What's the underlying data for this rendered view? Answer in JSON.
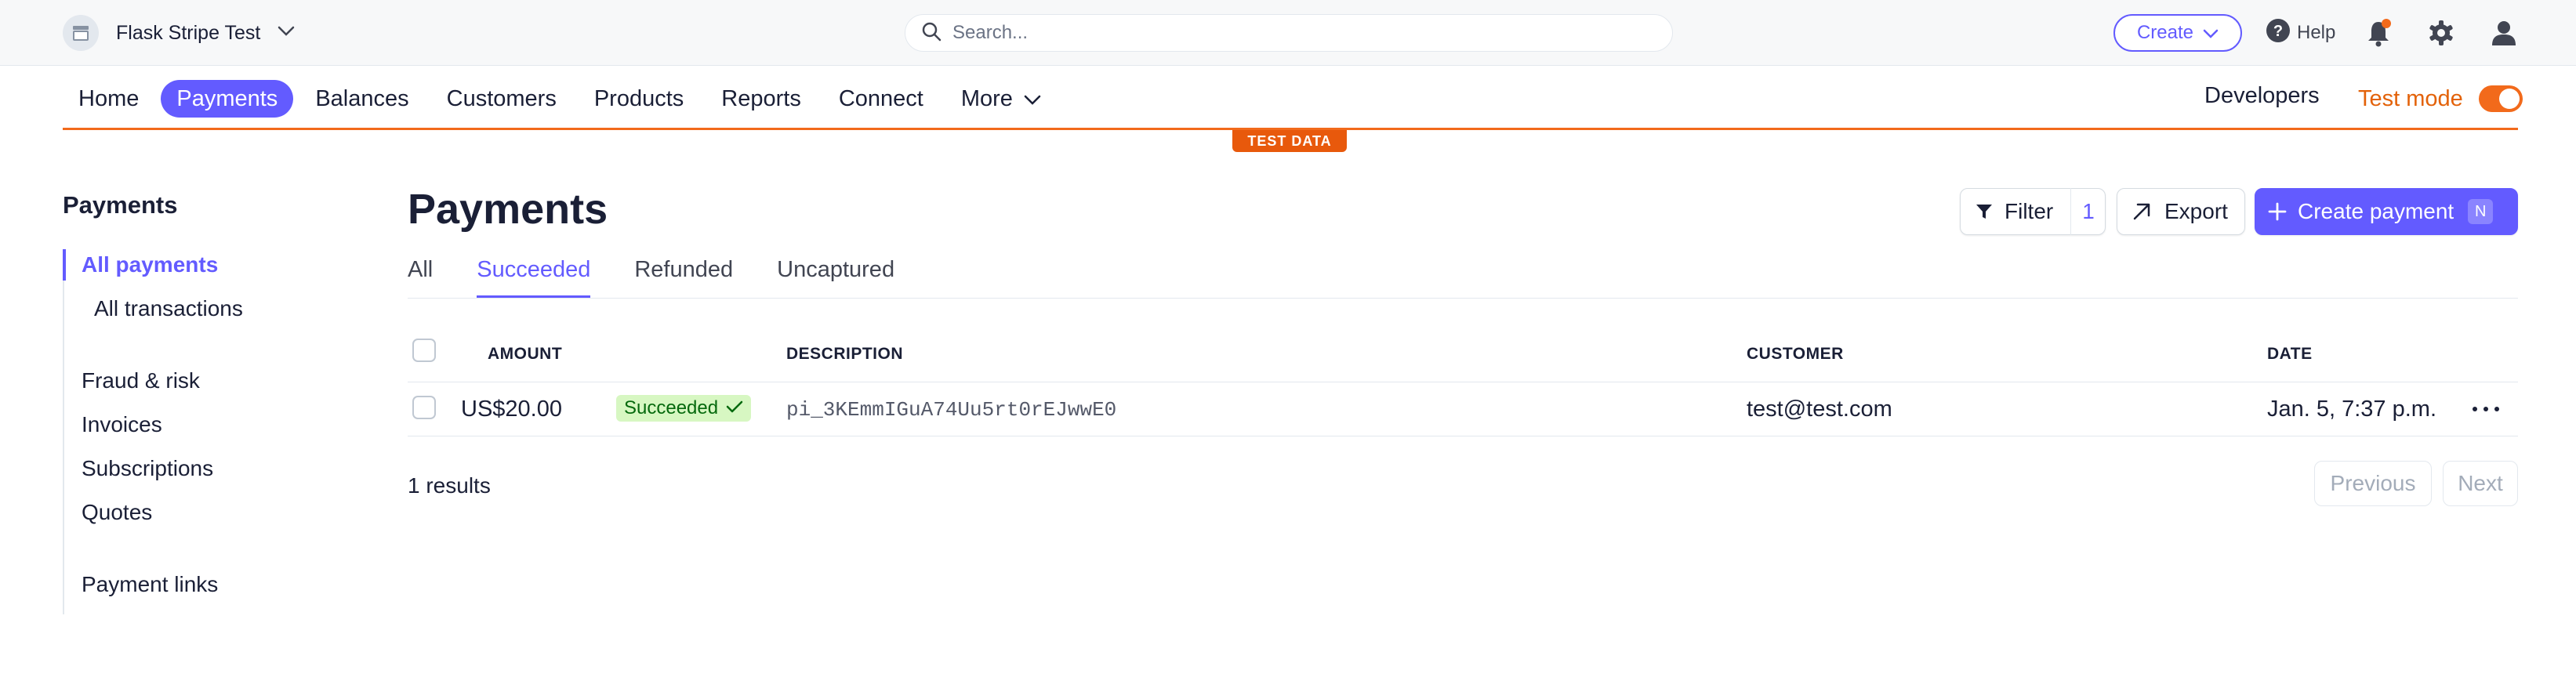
{
  "topbar": {
    "account_name": "Flask Stripe Test",
    "search_placeholder": "Search...",
    "create_label": "Create",
    "help_label": "Help"
  },
  "nav": {
    "items": [
      "Home",
      "Payments",
      "Balances",
      "Customers",
      "Products",
      "Reports",
      "Connect",
      "More"
    ],
    "active": "Payments",
    "developers_label": "Developers",
    "test_mode_label": "Test mode",
    "test_mode_on": true,
    "test_data_badge": "TEST DATA"
  },
  "sidebar": {
    "title": "Payments",
    "items": [
      "All payments",
      "All transactions",
      "Fraud & risk",
      "Invoices",
      "Subscriptions",
      "Quotes",
      "Payment links"
    ],
    "active": "All payments"
  },
  "main": {
    "title": "Payments",
    "filter_label": "Filter",
    "filter_count": "1",
    "export_label": "Export",
    "create_payment_label": "Create payment",
    "create_payment_shortcut": "N",
    "tabs": [
      "All",
      "Succeeded",
      "Refunded",
      "Uncaptured"
    ],
    "active_tab": "Succeeded",
    "table": {
      "headers": [
        "AMOUNT",
        "DESCRIPTION",
        "CUSTOMER",
        "DATE"
      ],
      "rows": [
        {
          "amount": "US$20.00",
          "status": "Succeeded",
          "description": "pi_3KEmmIGuA74Uu5rt0rEJwwE0",
          "customer": "test@test.com",
          "date": "Jan. 5, 7:37 p.m."
        }
      ]
    },
    "results_text": "1 results",
    "previous_label": "Previous",
    "next_label": "Next"
  },
  "colors": {
    "accent": "#635bff",
    "test_orange": "#f26a1b",
    "success_bg": "#d7f7c2",
    "success_text": "#05690d"
  }
}
